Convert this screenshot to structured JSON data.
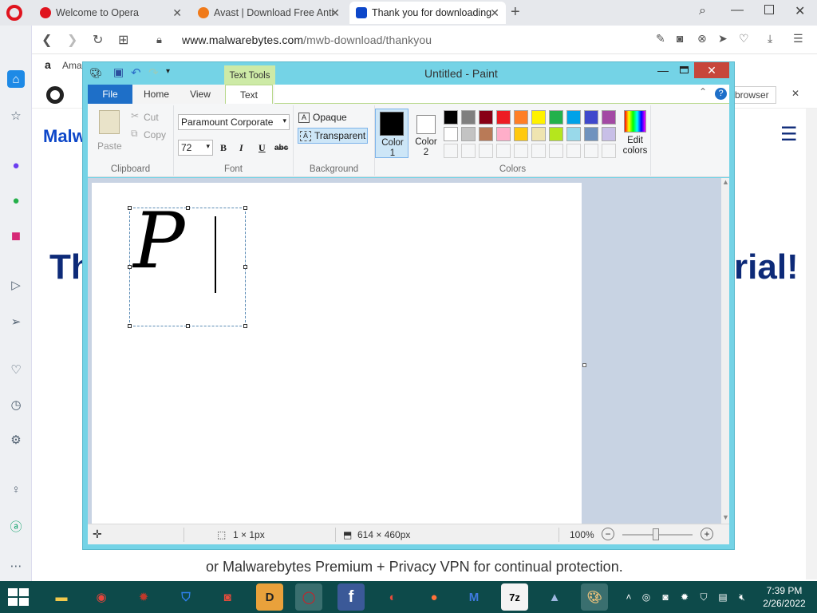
{
  "browser": {
    "tabs": [
      {
        "label": "Welcome to Opera",
        "icon": "opera-icon",
        "color": "#e0141e"
      },
      {
        "label": "Avast | Download Free Anti",
        "icon": "avast-icon",
        "color": "#f07a1a"
      },
      {
        "label": "Thank you for downloading",
        "icon": "malwarebytes-icon",
        "color": "#0d47c9"
      }
    ],
    "url_domain": "www.malwarebytes.com",
    "url_path": "/mwb-download/thankyou",
    "bookmark_label": "Ama",
    "banner_right": "browser"
  },
  "webpage": {
    "logo_text": "Malw",
    "title_left": "Th",
    "title_right": "rial!",
    "body_text": "or Malwarebytes Premium + Privacy VPN for continual protection."
  },
  "paint": {
    "title": "Untitled - Paint",
    "contextual_tab": "Text Tools",
    "tabs": {
      "file": "File",
      "home": "Home",
      "view": "View",
      "text": "Text"
    },
    "clipboard": {
      "paste": "Paste",
      "cut": "Cut",
      "copy": "Copy",
      "group": "Clipboard"
    },
    "font": {
      "name": "Paramount Corporate",
      "size": "72",
      "bold": "B",
      "italic": "I",
      "underline": "U",
      "strike": "abc",
      "group": "Font"
    },
    "background": {
      "opaque": "Opaque",
      "transparent": "Transparent",
      "group": "Background"
    },
    "colors": {
      "color1": "Color 1",
      "color2": "Color 2",
      "edit": "Edit colors",
      "group": "Colors",
      "color1_value": "#000000",
      "color2_value": "#ffffff",
      "palette_row1": [
        "#000000",
        "#7f7f7f",
        "#880015",
        "#ed1c24",
        "#ff7f27",
        "#fff200",
        "#22b14c",
        "#00a2e8",
        "#3f48cc",
        "#a349a4"
      ],
      "palette_row2": [
        "#ffffff",
        "#c3c3c3",
        "#b97a57",
        "#ffaec9",
        "#ffc90e",
        "#efe4b0",
        "#b5e61d",
        "#99d9ea",
        "#7092be",
        "#c8bfe7"
      ]
    },
    "canvas_text": "P",
    "status": {
      "selection": "1 × 1px",
      "size": "614 × 460px",
      "zoom": "100%"
    }
  },
  "taskbar": {
    "apps": [
      "File Explorer",
      "Chrome",
      "Avast",
      "Bitdefender",
      "Screen Recorder",
      "Adobe Acrobat",
      "Opera",
      "Facebook",
      "CCleaner",
      "Firefox",
      "Malwarebytes",
      "7-Zip",
      "VPN",
      "Paint"
    ],
    "time": "7:39 PM",
    "date": "2/26/2022"
  }
}
